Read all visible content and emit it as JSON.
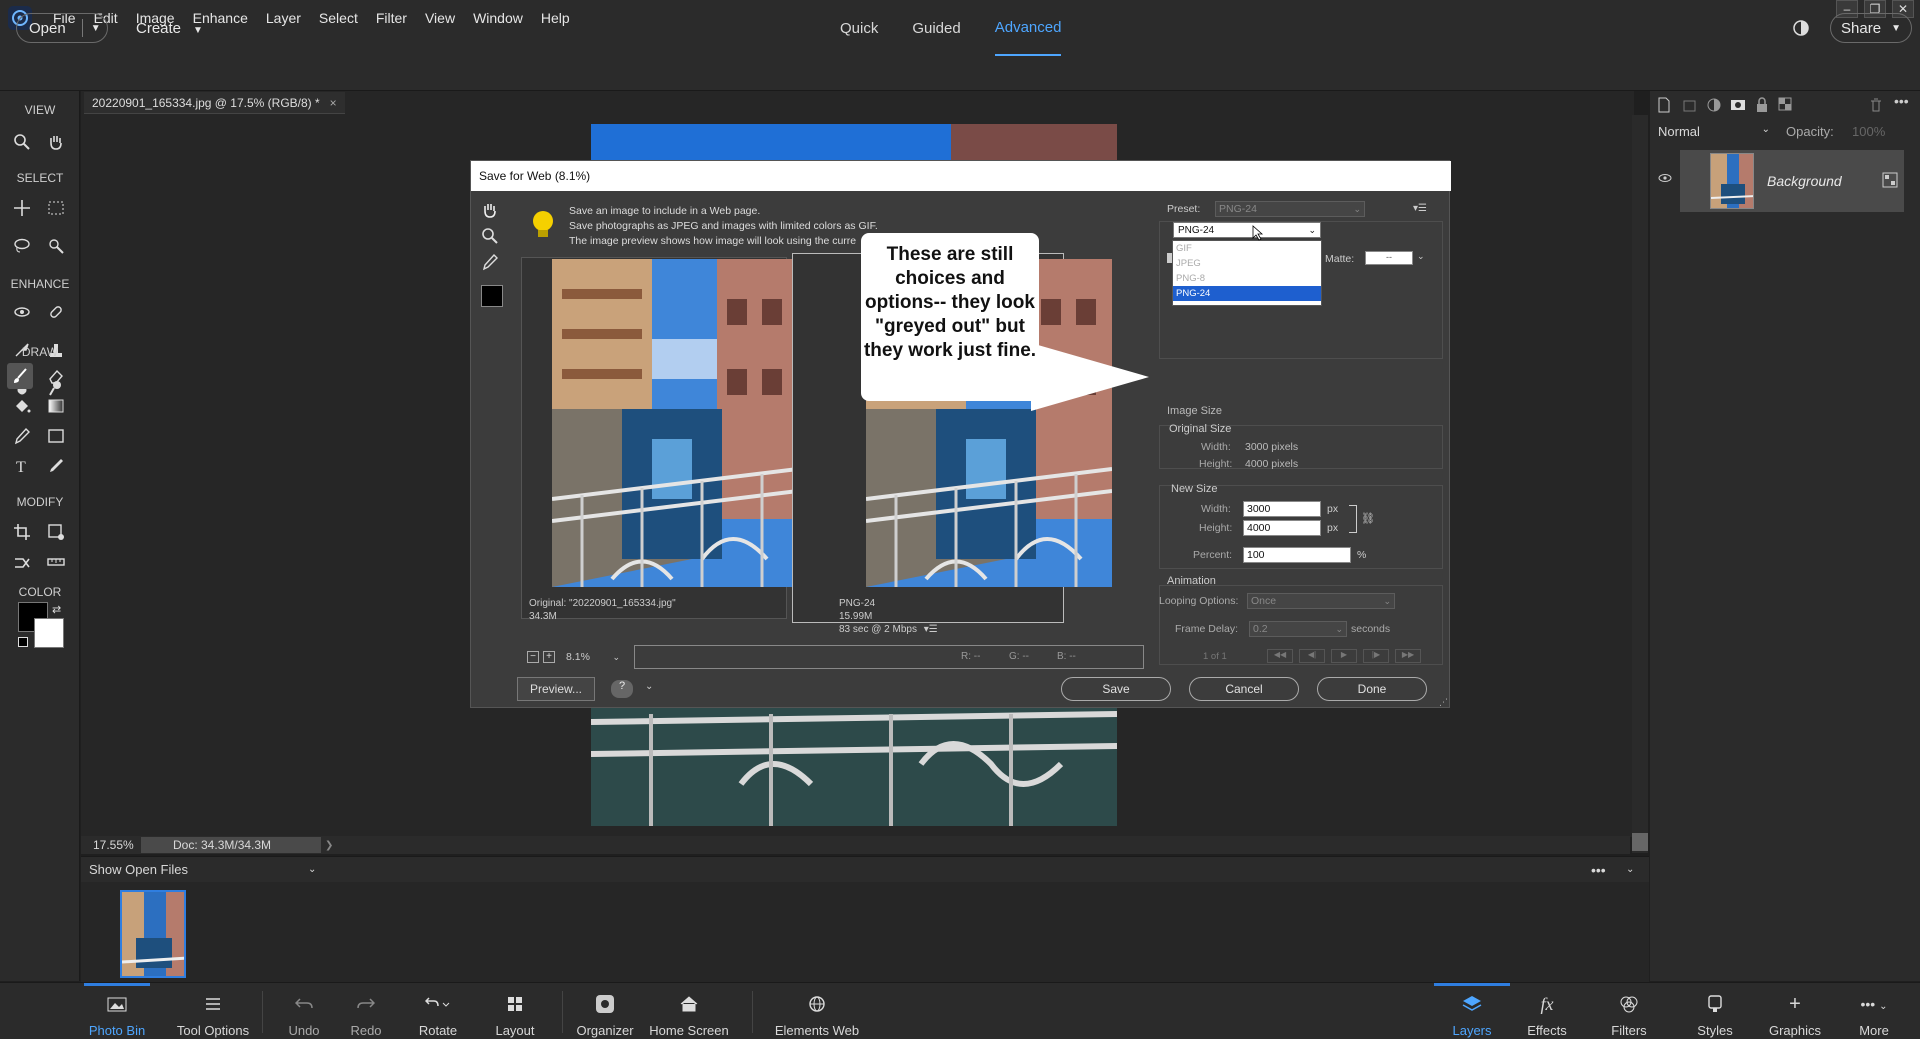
{
  "menubar": {
    "items": [
      "File",
      "Edit",
      "Image",
      "Enhance",
      "Layer",
      "Select",
      "Filter",
      "View",
      "Window",
      "Help"
    ]
  },
  "modebar": {
    "open_label": "Open",
    "create_label": "Create",
    "tabs": [
      "Quick",
      "Guided",
      "Advanced"
    ],
    "active_tab": "Advanced",
    "share_label": "Share"
  },
  "toolbox": {
    "sections": [
      "VIEW",
      "SELECT",
      "ENHANCE",
      "DRAW",
      "MODIFY",
      "COLOR"
    ]
  },
  "document": {
    "tab_title": "20220901_165334.jpg @ 17.5% (RGB/8) *",
    "zoom": "17.55%",
    "doc_size": "Doc: 34.3M/34.3M"
  },
  "layers_panel": {
    "blend_mode": "Normal",
    "opacity_label": "Opacity:",
    "opacity_value": "100%",
    "layer_name": "Background"
  },
  "photo_bin": {
    "header": "Show Open Files"
  },
  "bottombar": {
    "left": [
      "Photo Bin",
      "Tool Options",
      "Undo",
      "Redo",
      "Rotate",
      "Layout",
      "Organizer",
      "Home Screen",
      "Elements Web"
    ],
    "right": [
      "Layers",
      "Effects",
      "Filters",
      "Styles",
      "Graphics",
      "More"
    ]
  },
  "dialog": {
    "title": "Save for Web (8.1%)",
    "tip_lines": [
      "Save an image to include in a Web page.",
      "Save photographs as JPEG and images with limited colors as GIF.",
      "The image preview shows how image will look using the curre"
    ],
    "original_info": [
      "Original: \"20220901_165334.jpg\"",
      "34.3M"
    ],
    "optimized_info": [
      "PNG-24",
      "15.99M",
      "83 sec @ 2 Mbps"
    ],
    "zoom_value": "8.1%",
    "rgb_readout": [
      "R: --",
      "G: --",
      "B: --"
    ],
    "preview_button": "Preview...",
    "preset_label": "Preset:",
    "preset_value": "PNG-24",
    "format_value": "PNG-24",
    "format_options": [
      "GIF",
      "JPEG",
      "PNG-8",
      "PNG-24"
    ],
    "matte_label": "Matte:",
    "matte_value": "--",
    "image_size": {
      "title": "Image Size",
      "original_title": "Original Size",
      "width_label": "Width:",
      "width_value": "3000 pixels",
      "height_label": "Height:",
      "height_value": "4000 pixels",
      "new_title": "New Size",
      "new_width": "3000",
      "new_height": "4000",
      "unit": "px",
      "percent_label": "Percent:",
      "percent_value": "100",
      "percent_unit": "%"
    },
    "animation": {
      "title": "Animation",
      "looping_label": "Looping Options:",
      "looping_value": "Once",
      "frame_delay_label": "Frame Delay:",
      "frame_delay_value": "0.2",
      "frame_delay_unit": "seconds",
      "frame_counter": "1 of 1"
    },
    "buttons": {
      "save": "Save",
      "cancel": "Cancel",
      "done": "Done"
    },
    "callout_text": "These are still choices and options-- they look \"greyed out\" but they work just fine."
  }
}
